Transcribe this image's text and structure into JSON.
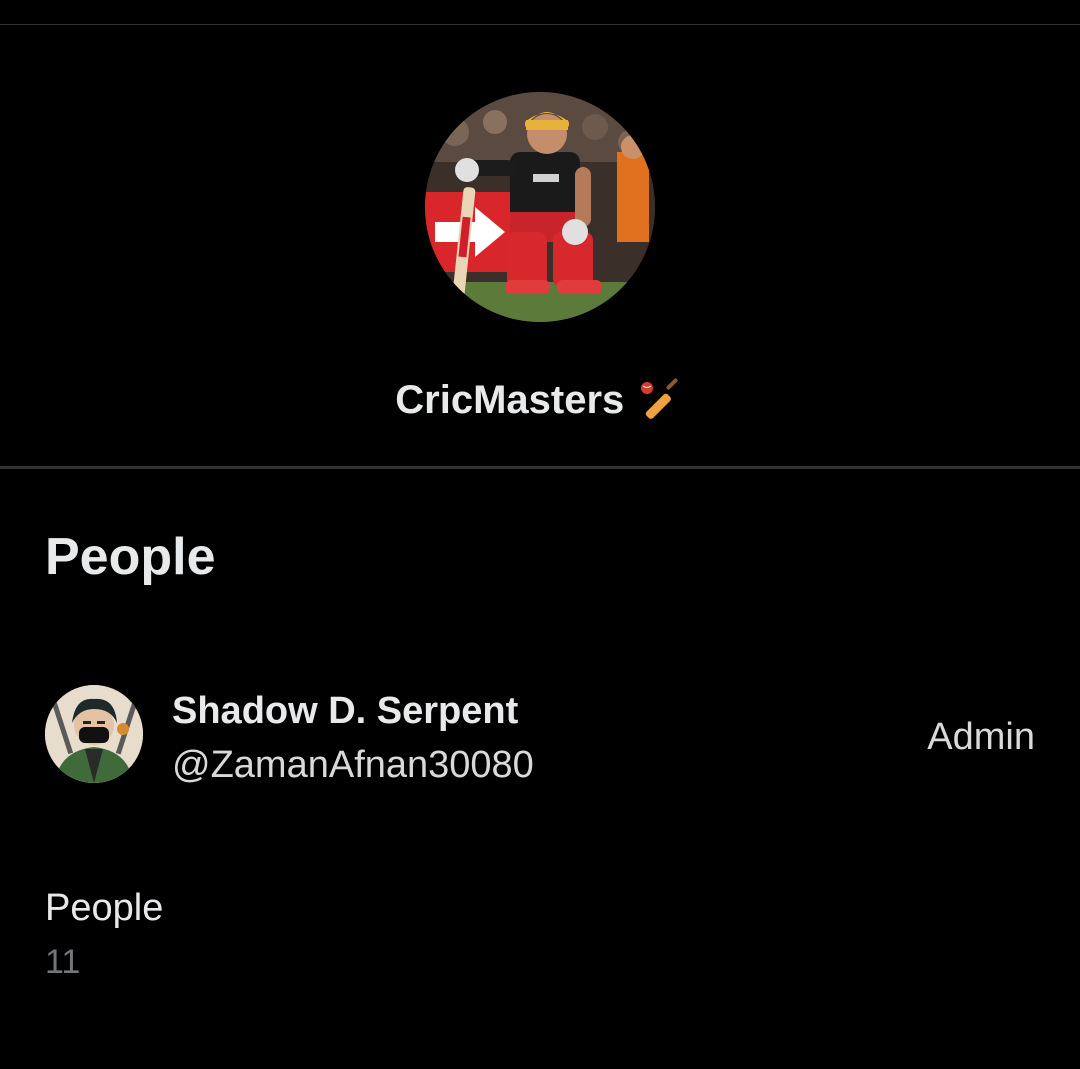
{
  "group": {
    "name": "CricMasters",
    "name_icon": "cricket-bat-and-ball-icon",
    "avatar": "cricketer-kneeling-with-bat-photo"
  },
  "people_section": {
    "title": "People",
    "members": [
      {
        "name": "Shadow D. Serpent",
        "handle": "@ZamanAfnan30080",
        "role": "Admin",
        "avatar": "masked-anime-character-avatar"
      }
    ]
  },
  "people_count": {
    "label": "People",
    "value": "11"
  },
  "colors": {
    "background": "#000000",
    "primary_text": "#e7e9ea",
    "secondary_text": "#71767b",
    "divider": "#2f3336"
  }
}
